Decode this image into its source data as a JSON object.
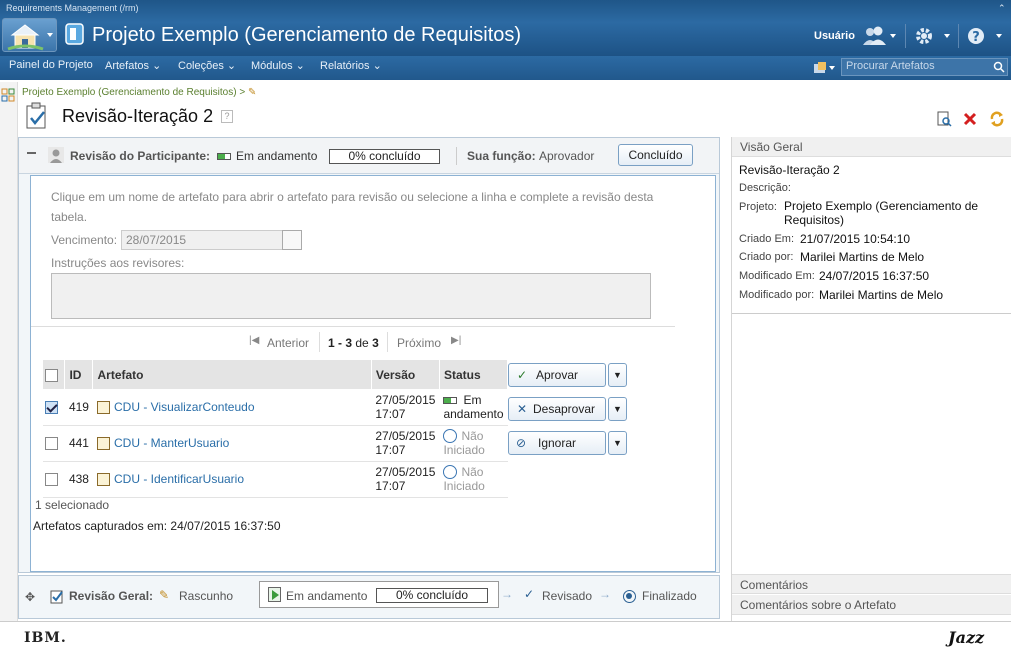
{
  "app": {
    "name": "Requirements Management (/rm)",
    "project_title": "Projeto Exemplo (Gerenciamento de Requisitos)",
    "user_label": "Usuário"
  },
  "nav": {
    "items": [
      "Painel do Projeto",
      "Artefatos",
      "Coleções",
      "Módulos",
      "Relatórios"
    ],
    "search_placeholder": "Procurar Artefatos"
  },
  "breadcrumb": "Projeto Exemplo (Gerenciamento de Requisitos) >",
  "page_title": "Revisão-Iteração 2",
  "participant": {
    "label": "Revisão do Participante:",
    "status": "Em andamento",
    "progress_text": "0% concluído",
    "progress": 0,
    "role_label": "Sua função:",
    "role": "Aprovador",
    "done_button": "Concluído"
  },
  "review": {
    "instructions_text": "Clique em um nome de artefato para abrir o artefato para revisão ou selecione a linha e complete a revisão desta tabela.",
    "due_label": "Vencimento:",
    "due_value": "28/07/2015",
    "reviewer_instructions_label": "Instruções aos revisores:",
    "pager": {
      "prev": "Anterior",
      "range": "1 - 3",
      "of": "de",
      "total": "3",
      "next": "Próximo"
    },
    "columns": [
      "ID",
      "Artefato",
      "Versão",
      "Status"
    ],
    "rows": [
      {
        "checked": true,
        "id": "419",
        "name": "CDU - VisualizarConteudo",
        "version": "27/05/2015 17:07",
        "status": "Em andamento"
      },
      {
        "checked": false,
        "id": "441",
        "name": "CDU - ManterUsuario",
        "version": "27/05/2015 17:07",
        "status": "Não Iniciado"
      },
      {
        "checked": false,
        "id": "438",
        "name": "CDU - IdentificarUsuario",
        "version": "27/05/2015 17:07",
        "status": "Não Iniciado"
      }
    ],
    "selected_text": "1 selecionado",
    "captured_text": "Artefatos capturados em: 24/07/2015 16:37:50",
    "actions": [
      "Aprovar",
      "Desaprovar",
      "Ignorar"
    ]
  },
  "overview": {
    "title": "Visão Geral",
    "name": "Revisão-Iteração 2",
    "description_label": "Descrição:",
    "project_label": "Projeto:",
    "project_value": "Projeto Exemplo (Gerenciamento de Requisitos)",
    "created_on_label": "Criado Em:",
    "created_on": "21/07/2015 10:54:10",
    "created_by_label": "Criado por:",
    "created_by": "Marilei Martins de Melo",
    "modified_on_label": "Modificado Em:",
    "modified_on": "24/07/2015 16:37:50",
    "modified_by_label": "Modificado por:",
    "modified_by": "Marilei Martins de Melo",
    "comments": "Comentários",
    "artifact_comments": "Comentários sobre o Artefato"
  },
  "general_review": {
    "label": "Revisão Geral:",
    "steps": [
      "Rascunho",
      "Em andamento",
      "Revisado",
      "Finalizado"
    ],
    "progress_text": "0% concluído",
    "progress": 0
  },
  "footer": {
    "left": "IBM.",
    "right": "Jazz"
  },
  "colors": {
    "topbar": "#2c6aa3",
    "link": "#2a6ea8",
    "accent_green": "#5a7f2e"
  }
}
